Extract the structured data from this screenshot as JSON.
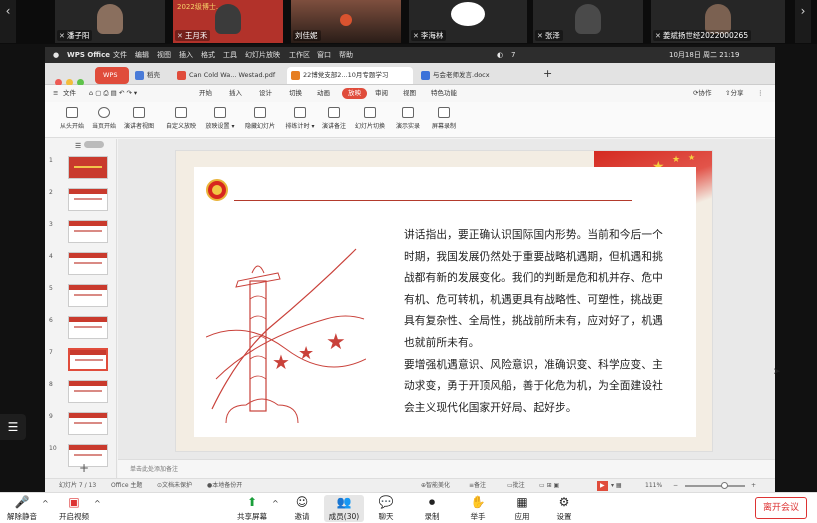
{
  "participants": [
    {
      "name": "潘子阳",
      "mic": "mic-muted"
    },
    {
      "name": "王月禾",
      "mic": "mic-muted",
      "banner": "2022级博士..."
    },
    {
      "name": "刘佳妮",
      "mic": ""
    },
    {
      "name": "李海林",
      "mic": "mic-muted"
    },
    {
      "name": "张泽",
      "mic": "mic-muted"
    },
    {
      "name": "姜斌扬世经2022000265",
      "mic": "mic-muted"
    }
  ],
  "strip_nav": {
    "prev": "‹",
    "next": "›"
  },
  "macbar": {
    "app": "WPS Office",
    "menus": [
      "文件",
      "编辑",
      "视图",
      "插入",
      "格式",
      "工具",
      "幻灯片放映",
      "工作区",
      "窗口",
      "帮助"
    ],
    "battery": "7",
    "date": "10月18日 周二 21:19"
  },
  "tabs": [
    {
      "label": "WPS",
      "color": "#e04c3b"
    },
    {
      "label": "稻壳",
      "color": "#4a7bd8"
    },
    {
      "label": "Can Cold Wa... Westad.pdf",
      "color": "#e04c3b"
    },
    {
      "label": "22博党支部2...10月专题学习",
      "color": "#e67e22"
    },
    {
      "label": "与会老师发言.docx",
      "color": "#3b72d9"
    }
  ],
  "ribbon_menu": {
    "file": "文件",
    "items": [
      "开始",
      "插入",
      "设计",
      "切换",
      "动画",
      "放映",
      "审阅",
      "视图",
      "特色功能"
    ],
    "selected": "放映",
    "collab": "协作",
    "share": "分享"
  },
  "ribbon_tools": [
    "从头开始",
    "当页开始",
    "演讲者视图",
    "自定义放映",
    "放映设置",
    "隐藏幻灯片",
    "排练计时",
    "演讲备注",
    "幻灯片切换",
    "演示实录",
    "屏幕录制"
  ],
  "thumbnails": {
    "numbers": [
      "1",
      "2",
      "3",
      "4",
      "5",
      "6",
      "7",
      "8",
      "9",
      "10"
    ],
    "selected": "7",
    "add": "+"
  },
  "slide": {
    "paragraph1": "讲话指出，要正确认识国际国内形势。当前和今后一个时期，我国发展仍然处于重要战略机遇期，但机遇和挑战都有新的发展变化。我们的判断是危和机并存、危中有机、危可转机，机遇更具有战略性、可塑性，挑战更具有复杂性、全局性，挑战前所未有，应对好了，机遇也就前所未有。",
    "paragraph2": "要增强机遇意识、风险意识，准确识变、科学应变、主动求变，勇于开顶风船，善于化危为机，为全面建设社会主义现代化国家开好局、起好步。"
  },
  "notes_placeholder": "单击此处添加备注",
  "status": {
    "slide": "幻灯片 7 / 13",
    "theme": "Office 主题",
    "protect": "文档未保护",
    "backup": "本地备份开",
    "beautify": "智能美化",
    "notes": "备注",
    "comment": "批注",
    "zoom": "111%"
  },
  "meeting_bar": {
    "tools": [
      {
        "label": "解除静音",
        "icon": "🎤"
      },
      {
        "label": "开启视频",
        "icon": "▣"
      },
      {
        "label": "共享屏幕",
        "icon": "⬆"
      },
      {
        "label": "邀请",
        "icon": "☺"
      },
      {
        "label": "成员(30)",
        "icon": "👥"
      },
      {
        "label": "聊天",
        "icon": "💬"
      },
      {
        "label": "录制",
        "icon": "⏺"
      },
      {
        "label": "举手",
        "icon": "✋"
      },
      {
        "label": "应用",
        "icon": "▦"
      },
      {
        "label": "设置",
        "icon": "⚙"
      }
    ],
    "leave": "离开会议"
  },
  "colors": {
    "accent": "#e04c3b",
    "leave": "#d33333"
  }
}
